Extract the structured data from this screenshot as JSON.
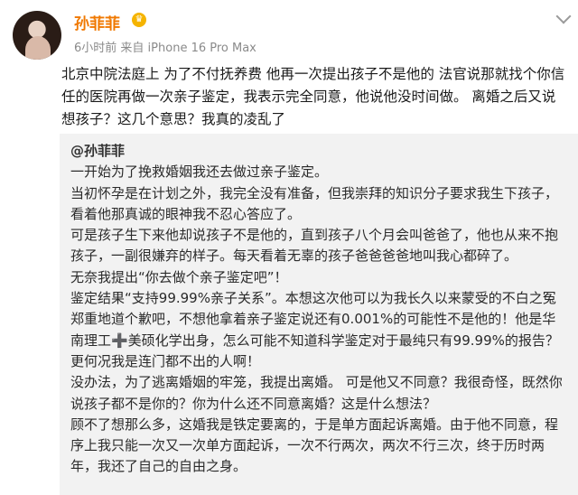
{
  "author": {
    "name": "孙菲菲",
    "time": "6小时前",
    "source": "来自 iPhone 16 Pro Max"
  },
  "post": {
    "text": "北京中院法庭上 为了不付抚养费 他再一次提出孩子不是他的 法官说那就找个你信任的医院再做一次亲子鉴定，我表示完全同意，他说他没时间做。 离婚之后又说想孩子？这几个意思？我真的凌乱了"
  },
  "quote": {
    "author": "@孙菲菲",
    "paragraphs": [
      "一开始为了挽救婚姻我还去做过亲子鉴定。",
      "当初怀孕是在计划之外，我完全没有准备，但我崇拜的知识分子要求我生下孩子，看着他那真诚的眼神我不忍心答应了。",
      "可是孩子生下来他却说孩子不是他的，直到孩子八个月会叫爸爸了，他也从来不抱孩子，一副很嫌弃的样子。每天看着无辜的孩子爸爸爸爸地叫我心都碎了。",
      "无奈我提出“你去做个亲子鉴定吧”！",
      "鉴定结果“支持99.99%亲子关系”。本想这次他可以为我长久以来蒙受的不白之冤郑重地道个歉吧，不想他拿着亲子鉴定说还有0.001%的可能性不是他的！他是华南理工➕美硕化学出身，怎么可能不知道科学鉴定对于最纯只有99.99%的报告？更何况我是连门都不出的人啊！",
      "没办法，为了逃离婚姻的牢笼，我提出离婚。 可是他又不同意？我很奇怪，既然你说孩子都不是你的？你为什么还不同意离婚？这是什么想法？",
      "顾不了想那么多，这婚我是铁定要离的，于是单方面起诉离婚。由于他不同意，程序上我只能一次又一次单方面起诉，一次不行两次，两次不行三次，终于历时两年，我还了自己的自由之身。"
    ]
  },
  "icons": {
    "badge": "crown-icon",
    "menu": "chevron-down-icon"
  },
  "colors": {
    "name": "#f07800",
    "meta": "#8a8a8a",
    "quote_bg": "#f2f2f2"
  }
}
